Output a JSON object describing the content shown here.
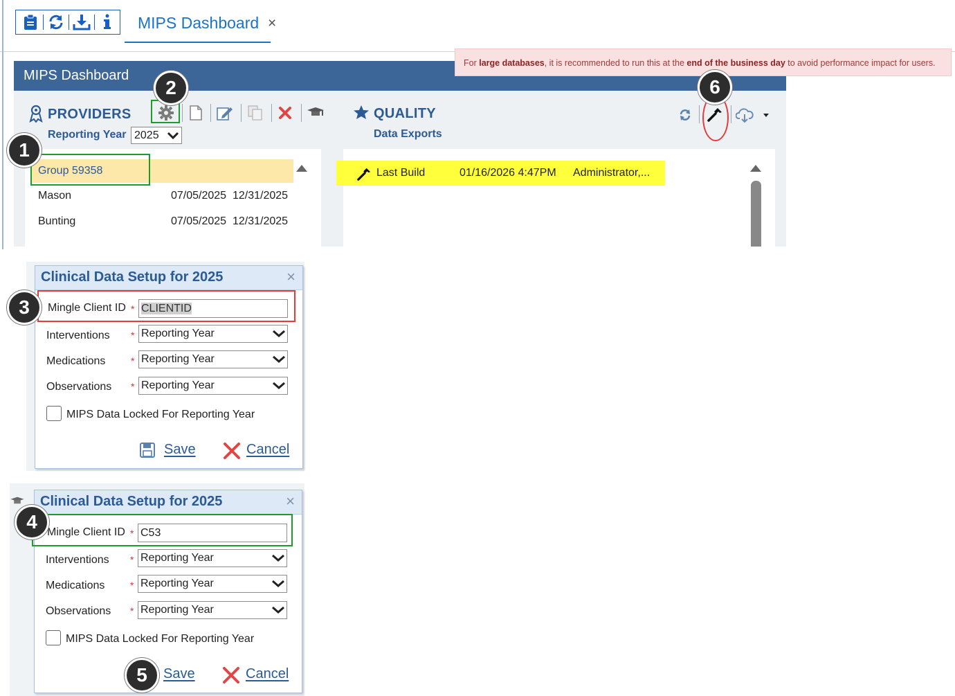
{
  "app": {
    "tab_title": "MIPS Dashboard",
    "tab_close": "×"
  },
  "notice": {
    "p1": "For ",
    "b1": "large databases",
    "p2": ", it is recommended to run this at the ",
    "b2": "end of the business day",
    "p3": " to avoid performance impact for users."
  },
  "dashboard": {
    "title": "MIPS Dashboard",
    "providers": {
      "title": "PROVIDERS",
      "reporting_year_label": "Reporting Year",
      "reporting_year_value": "2025",
      "rows": [
        {
          "name": "Group 59358",
          "start": "",
          "end": ""
        },
        {
          "name": "Mason",
          "start": "07/05/2025",
          "end": "12/31/2025"
        },
        {
          "name": "Bunting",
          "start": "07/05/2025",
          "end": "12/31/2025"
        }
      ]
    },
    "quality": {
      "title": "QUALITY",
      "subtitle": "Data Exports",
      "rows": [
        {
          "label": "Last Build",
          "date": "01/16/2026 4:47PM",
          "user": "Administrator,..."
        }
      ]
    }
  },
  "dialog1": {
    "title": "Clinical Data Setup for 2025",
    "close": "×",
    "mingle_label": "Mingle Client ID",
    "mingle_value": "CLIENTID",
    "interventions_label": "Interventions",
    "interventions_value": "Reporting Year",
    "medications_label": "Medications",
    "medications_value": "Reporting Year",
    "observations_label": "Observations",
    "observations_value": "Reporting Year",
    "locked_label": "MIPS Data Locked For Reporting Year",
    "locked": false,
    "save": "Save",
    "cancel": "Cancel",
    "required_mark": "*"
  },
  "dialog2": {
    "title": "Clinical Data Setup for 2025",
    "close": "×",
    "mingle_label": "Mingle Client ID",
    "mingle_value": "C53",
    "interventions_label": "Interventions",
    "interventions_value": "Reporting Year",
    "medications_label": "Medications",
    "medications_value": "Reporting Year",
    "observations_label": "Observations",
    "observations_value": "Reporting Year",
    "locked_label": "MIPS Data Locked For Reporting Year",
    "locked": false,
    "save": "Save",
    "cancel": "Cancel",
    "required_mark": "*"
  },
  "callouts": [
    "1",
    "2",
    "3",
    "4",
    "5",
    "6"
  ],
  "colors": {
    "accent": "#1a73c9",
    "header": "#3b6697",
    "title_blue": "#2b5a94",
    "selected_row": "#fde7a9",
    "highlight_row": "#ffff3c",
    "callout_green": "#1f9a2f",
    "callout_red": "#e23b3b"
  }
}
